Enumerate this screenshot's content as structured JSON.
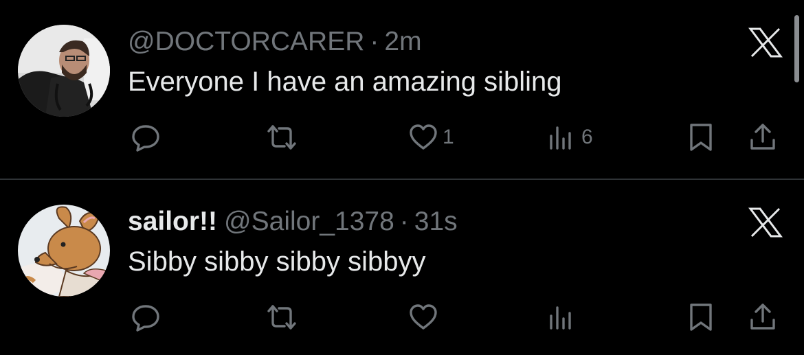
{
  "tweets": [
    {
      "display_name": "",
      "handle": "@DOCTORCARER",
      "separator": "·",
      "time": "2m",
      "text": "Everyone I have an amazing sibling",
      "avatar_icon": "doctor-photo-avatar",
      "actions": {
        "reply_count": "",
        "retweet_count": "",
        "like_count": "1",
        "views_count": "6"
      }
    },
    {
      "display_name": "sailor!!",
      "handle": "@Sailor_1378",
      "separator": "·",
      "time": "31s",
      "text": "Sibby sibby sibby sibbyy",
      "avatar_icon": "cartoon-kangaroo-avatar",
      "actions": {
        "reply_count": "",
        "retweet_count": "",
        "like_count": "",
        "views_count": ""
      }
    }
  ],
  "colors": {
    "background": "#000000",
    "primary_text": "#e7e9ea",
    "secondary_text": "#71767b",
    "divider": "#2f3336"
  }
}
